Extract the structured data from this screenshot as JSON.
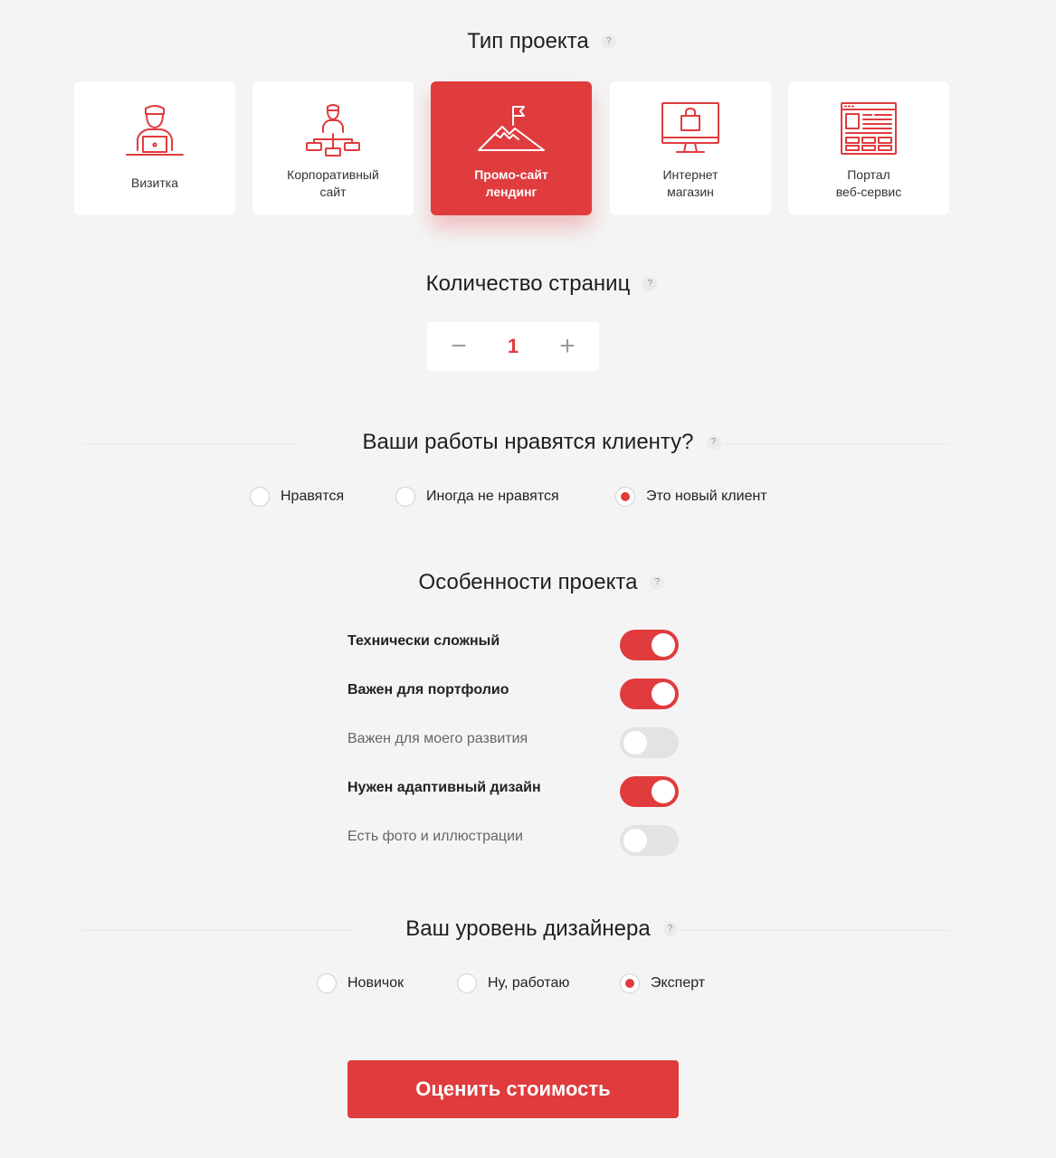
{
  "colors": {
    "accent": "#e03b3d",
    "background": "#f4f4f4",
    "card": "#ffffff"
  },
  "project_type": {
    "title": "Тип проекта",
    "help": "?",
    "cards": [
      {
        "icon": "person-laptop-icon",
        "line1": "Визитка",
        "line2": "",
        "selected": false
      },
      {
        "icon": "org-structure-icon",
        "line1": "Корпоративный",
        "line2": "сайт",
        "selected": false
      },
      {
        "icon": "mountain-flag-icon",
        "line1": "Промо-сайт",
        "line2": "лендинг",
        "selected": true
      },
      {
        "icon": "monitor-bag-icon",
        "line1": "Интернет",
        "line2": "магазин",
        "selected": false
      },
      {
        "icon": "web-layout-icon",
        "line1": "Портал",
        "line2": "веб-сервис",
        "selected": false
      }
    ]
  },
  "pages": {
    "title": "Количество страниц",
    "help": "?",
    "minus": "−",
    "value": "1",
    "plus": "+"
  },
  "client": {
    "title": "Ваши работы нравятся клиенту?",
    "help": "?",
    "options": [
      {
        "label": "Нравятся",
        "checked": false
      },
      {
        "label": "Иногда не нравятся",
        "checked": false
      },
      {
        "label": "Это новый клиент",
        "checked": true
      }
    ]
  },
  "features": {
    "title": "Особенности проекта",
    "help": "?",
    "items": [
      {
        "label": "Технически сложный",
        "on": true
      },
      {
        "label": "Важен для портфолио",
        "on": true
      },
      {
        "label": "Важен для моего развития",
        "on": false
      },
      {
        "label": "Нужен адаптивный дизайн",
        "on": true
      },
      {
        "label": "Есть фото и иллюстрации",
        "on": false
      }
    ]
  },
  "level": {
    "title": "Ваш уровень дизайнера",
    "help": "?",
    "options": [
      {
        "label": "Новичок",
        "checked": false
      },
      {
        "label": "Ну, работаю",
        "checked": false
      },
      {
        "label": "Эксперт",
        "checked": true
      }
    ]
  },
  "submit_label": "Оценить стоимость"
}
